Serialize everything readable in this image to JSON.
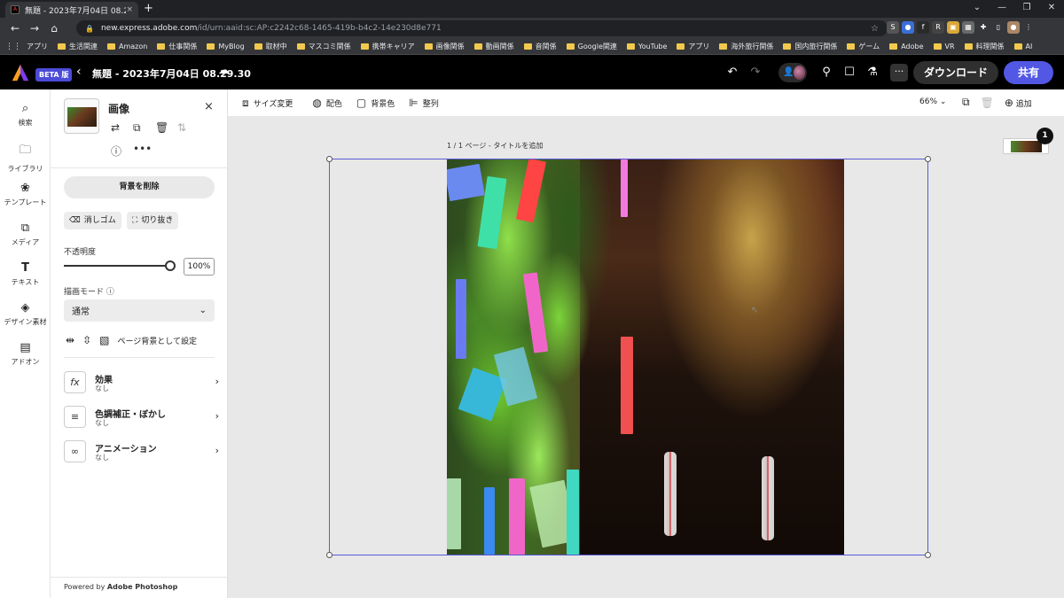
{
  "browser": {
    "tab_title": "無題 - 2023年7月04日 08.29.30",
    "tab_close": "×",
    "new_tab": "+",
    "url_host": "new.express.adobe.com",
    "url_path": "/id/urn:aaid:sc:AP:c2242c68-1465-419b-b4c2-14e230d8e771",
    "bookmarks": [
      "アプリ",
      "生活関連",
      "Amazon",
      "仕事関係",
      "MyBlog",
      "取材中",
      "マスコミ関係",
      "携帯キャリア",
      "画像関係",
      "動画関係",
      "音関係",
      "Google関連",
      "YouTube",
      "アプリ",
      "海外旅行関係",
      "国内旅行関係",
      "ゲーム",
      "Adobe",
      "VR",
      "料理関係",
      "AI"
    ]
  },
  "app": {
    "beta_label": "BETA 版",
    "doc_title": "無題 - 2023年7月04日 08.29.30",
    "download_label": "ダウンロード",
    "share_label": "共有",
    "more_label": "···"
  },
  "rail": {
    "items": [
      {
        "label": "検索",
        "icon": "search-icon"
      },
      {
        "label": "ライブラリ",
        "icon": "folder-icon"
      },
      {
        "label": "テンプレート",
        "icon": "template-icon"
      },
      {
        "label": "メディア",
        "icon": "media-icon"
      },
      {
        "label": "テキスト",
        "icon": "text-icon"
      },
      {
        "label": "デザイン素材",
        "icon": "shapes-icon"
      },
      {
        "label": "アドオン",
        "icon": "addon-icon"
      }
    ]
  },
  "panel": {
    "title": "画像",
    "close": "×",
    "remove_bg": "背景を削除",
    "eraser": "消しゴム",
    "crop": "切り抜き",
    "opacity_label": "不透明度",
    "opacity_value": "100%",
    "opacity_level": 1.0,
    "blend_label": "描画モード",
    "blend_value": "通常",
    "set_page_bg": "ページ背景として設定",
    "effects": [
      {
        "title": "効果",
        "sub": "なし",
        "icon": "fx"
      },
      {
        "title": "色調補正・ぼかし",
        "sub": "なし",
        "icon": "≡"
      },
      {
        "title": "アニメーション",
        "sub": "なし",
        "icon": "∞"
      }
    ],
    "powered_prefix": "Powered by ",
    "powered_brand": "Adobe Photoshop"
  },
  "toolbar": {
    "resize": "サイズ変更",
    "color": "配色",
    "background": "背景色",
    "align": "整列",
    "zoom": "66%",
    "add": "追加"
  },
  "canvas": {
    "page_label": "1 / 1 ページ - タイトルを追加",
    "page_count_badge": "1"
  },
  "colors": {
    "accent": "#5258e4",
    "selection": "#5a5ad8",
    "beta_bg": "#4b4bd8"
  }
}
